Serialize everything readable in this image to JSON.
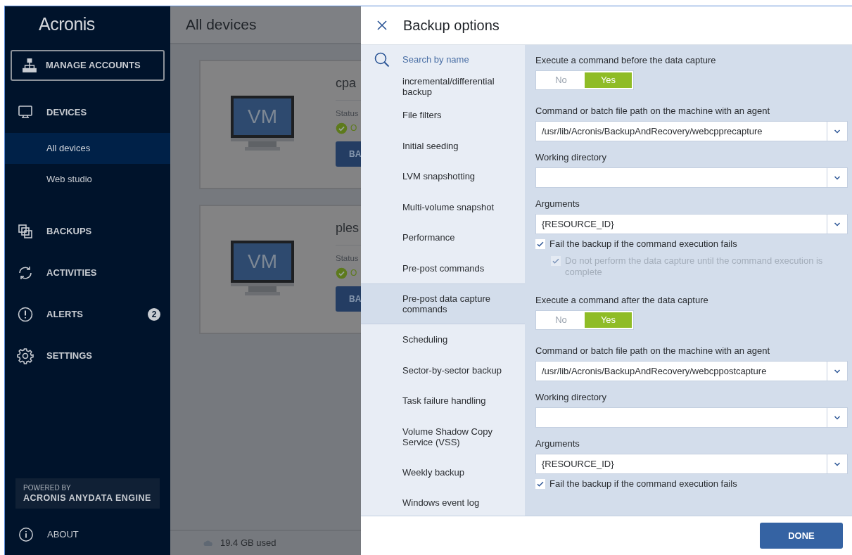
{
  "sidebar": {
    "logo": "Acronis",
    "manage_accounts": "MANAGE ACCOUNTS",
    "items": [
      {
        "kind": "section",
        "label": "DEVICES",
        "selected": false
      },
      {
        "kind": "sub",
        "label": "All devices",
        "selected": true
      },
      {
        "kind": "sub",
        "label": "Web studio",
        "selected": false
      },
      {
        "kind": "section",
        "label": "BACKUPS",
        "selected": false
      },
      {
        "kind": "section",
        "label": "ACTIVITIES",
        "selected": false
      },
      {
        "kind": "section",
        "label": "ALERTS",
        "badge": "2",
        "selected": false
      },
      {
        "kind": "section",
        "label": "SETTINGS",
        "selected": false
      }
    ],
    "powered": {
      "line1": "POWERED BY",
      "line2": "ACRONIS ANYDATA ENGINE"
    },
    "about": "ABOUT"
  },
  "main": {
    "title": "All devices",
    "devices": [
      {
        "screen": "VM",
        "name": "cpa",
        "status_label": "Status",
        "status": "O",
        "button": "BA"
      },
      {
        "screen": "VM",
        "name": "ples",
        "status_label": "Status",
        "status": "O",
        "button": "BA"
      }
    ],
    "storage": "19.4 GB used"
  },
  "panel": {
    "title": "Backup options",
    "search": {
      "placeholder": "Search by name"
    },
    "options": [
      {
        "label": "incremental/differential backup",
        "selected": false
      },
      {
        "label": "File filters",
        "selected": false
      },
      {
        "label": "Initial seeding",
        "selected": false
      },
      {
        "label": "LVM snapshotting",
        "selected": false
      },
      {
        "label": "Multi-volume snapshot",
        "selected": false
      },
      {
        "label": "Performance",
        "selected": false
      },
      {
        "label": "Pre-post commands",
        "selected": false
      },
      {
        "label": "Pre-post data capture commands",
        "selected": true
      },
      {
        "label": "Scheduling",
        "selected": false
      },
      {
        "label": "Sector-by-sector backup",
        "selected": false
      },
      {
        "label": "Task failure handling",
        "selected": false
      },
      {
        "label": "Volume Shadow Copy Service (VSS)",
        "selected": false
      },
      {
        "label": "Weekly backup",
        "selected": false
      },
      {
        "label": "Windows event log",
        "selected": false
      }
    ],
    "sections": [
      {
        "toggle_label": "Execute a command before the data capture",
        "toggle": [
          {
            "label": "No",
            "selected": false
          },
          {
            "label": "Yes",
            "selected": true
          }
        ],
        "fields": [
          {
            "label": "Command or batch file path on the machine with an agent",
            "value": "/usr/lib/Acronis/BackupAndRecovery/webcpprecapture"
          },
          {
            "label": "Working directory"
          },
          {
            "label": "Arguments",
            "value": "{RESOURCE_ID}"
          }
        ],
        "checks": [
          {
            "label": "Fail the backup if the command execution fails",
            "checked": true,
            "disabled": false,
            "children": [
              {
                "label": "Do not perform the data capture until the command execution is complete",
                "checked": true,
                "disabled": true
              }
            ]
          }
        ]
      },
      {
        "toggle_label": "Execute a command after the data capture",
        "toggle": [
          {
            "label": "No",
            "selected": false
          },
          {
            "label": "Yes",
            "selected": true
          }
        ],
        "fields": [
          {
            "label": "Command or batch file path on the machine with an agent",
            "value": "/usr/lib/Acronis/BackupAndRecovery/webcppostcapture"
          },
          {
            "label": "Working directory"
          },
          {
            "label": "Arguments",
            "value": "{RESOURCE_ID}"
          }
        ],
        "checks": [
          {
            "label": "Fail the backup if the command execution fails",
            "checked": true,
            "disabled": false
          }
        ]
      }
    ],
    "done": "DONE"
  }
}
